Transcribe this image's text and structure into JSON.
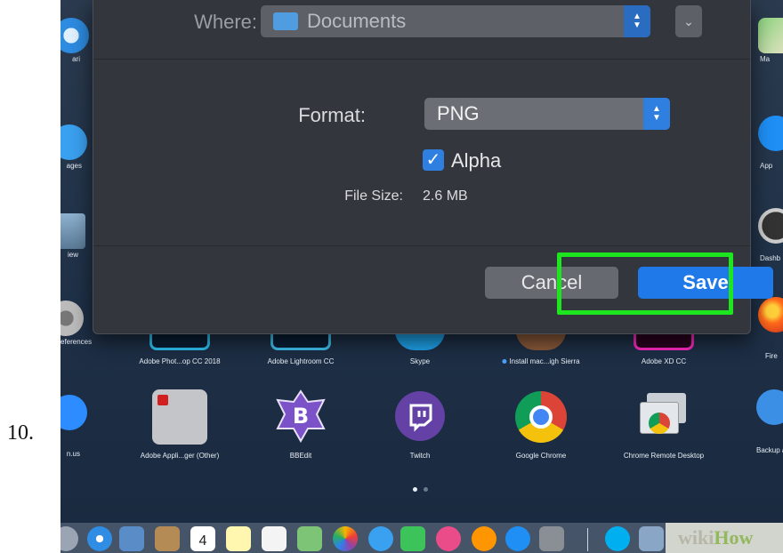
{
  "step_number": "10.",
  "dialog": {
    "where_label": "Where:",
    "where_value": "Documents",
    "format_label": "Format:",
    "format_value": "PNG",
    "alpha_label": "Alpha",
    "alpha_checked": true,
    "filesize_label": "File Size:",
    "filesize_value": "2.6 MB",
    "cancel_label": "Cancel",
    "save_label": "Save"
  },
  "side_apps_left": [
    {
      "label": "ari",
      "icon": "safari-icon"
    },
    {
      "label": "ages",
      "icon": "messages-icon"
    },
    {
      "label": "iew",
      "icon": "preview-icon"
    },
    {
      "label": "eferences",
      "icon": "system-preferences-icon"
    },
    {
      "label": "n.us",
      "icon": "zoom-icon"
    }
  ],
  "side_apps_right": [
    {
      "label": "Ma",
      "icon": "maps-icon"
    },
    {
      "label": "App",
      "icon": "app-store-icon"
    },
    {
      "label": "Dashb",
      "icon": "dashboard-icon"
    },
    {
      "label": "Fire",
      "icon": "firefox-icon"
    },
    {
      "label": "Backup and...",
      "icon": "backup-icon"
    }
  ],
  "launchpad_row1": [
    {
      "label": "Adobe Phot...op CC 2018"
    },
    {
      "label": "Adobe Lightroom CC"
    },
    {
      "label": "Skype"
    },
    {
      "label": "Install mac...igh Sierra"
    },
    {
      "label": "Adobe XD CC"
    }
  ],
  "launchpad_row2": [
    {
      "label": "Adobe Appli...ger (Other)",
      "icon": "adobe-app-manager-icon"
    },
    {
      "label": "BBEdit",
      "icon": "bbedit-icon"
    },
    {
      "label": "Twitch",
      "icon": "twitch-icon"
    },
    {
      "label": "Google Chrome",
      "icon": "chrome-icon"
    },
    {
      "label": "Chrome Remote Desktop",
      "icon": "chrome-remote-desktop-icon"
    }
  ],
  "dock": {
    "calendar_day": "4",
    "watermark_wiki": "wiki",
    "watermark_how": "How"
  },
  "colors": {
    "accent": "#2f7fe0",
    "highlight": "#1ee61e",
    "dialog_bg": "#33373d"
  }
}
